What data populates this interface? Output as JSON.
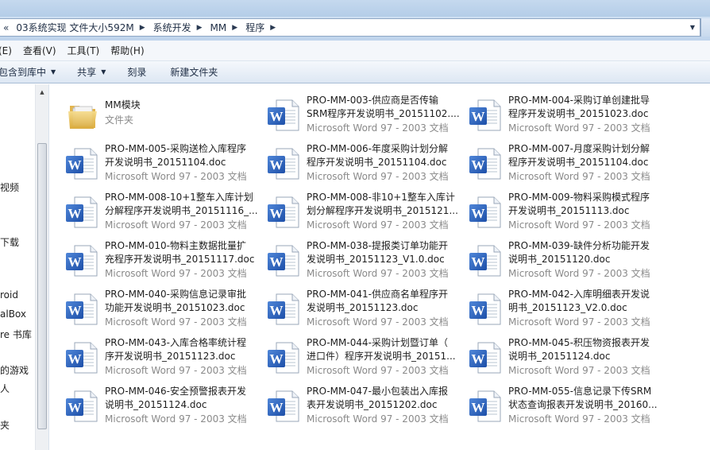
{
  "address": {
    "lead": "«",
    "crumbs": [
      "03系统实现 文件大小592M",
      "系统开发",
      "MM",
      "程序"
    ]
  },
  "menu": [
    "(E)",
    "查看(V)",
    "工具(T)",
    "帮助(H)"
  ],
  "commands": {
    "include_library": "包含到库中",
    "share": "共享",
    "burn": "刻录",
    "new_folder": "新建文件夹"
  },
  "nav": [
    "视频",
    "下载",
    "roid",
    "alBox",
    "re 书库",
    "的游戏",
    "人",
    "夹"
  ],
  "files": [
    {
      "line1": "MM模块",
      "line2": "",
      "line3": "文件夹",
      "icon": "folder-icon"
    },
    {
      "line1": "PRO-MM-003-供应商是否传输",
      "line2": "SRM程序开发说明书_20151102....",
      "line3": "Microsoft Word 97 - 2003 文档",
      "icon": "word-doc-icon"
    },
    {
      "line1": "PRO-MM-004-采购订单创建批导",
      "line2": "程序开发说明书_20151023.doc",
      "line3": "Microsoft Word 97 - 2003 文档",
      "icon": "word-doc-icon"
    },
    {
      "line1": "PRO-MM-005-采购送检入库程序",
      "line2": "开发说明书_20151104.doc",
      "line3": "Microsoft Word 97 - 2003 文档",
      "icon": "word-doc-icon"
    },
    {
      "line1": "PRO-MM-006-年度采购计划分解",
      "line2": "程序开发说明书_20151104.doc",
      "line3": "Microsoft Word 97 - 2003 文档",
      "icon": "word-doc-icon"
    },
    {
      "line1": "PRO-MM-007-月度采购计划分解",
      "line2": "程序开发说明书_20151104.doc",
      "line3": "Microsoft Word 97 - 2003 文档",
      "icon": "word-doc-icon"
    },
    {
      "line1": "PRO-MM-008-10+1整车入库计划",
      "line2": "分解程序开发说明书_20151116_...",
      "line3": "Microsoft Word 97 - 2003 文档",
      "icon": "word-doc-icon"
    },
    {
      "line1": "PRO-MM-008-非10+1整车入库计",
      "line2": "划分解程序开发说明书_2015121...",
      "line3": "Microsoft Word 97 - 2003 文档",
      "icon": "word-doc-icon"
    },
    {
      "line1": "PRO-MM-009-物料采购模式程序",
      "line2": "开发说明书_20151113.doc",
      "line3": "Microsoft Word 97 - 2003 文档",
      "icon": "word-doc-icon"
    },
    {
      "line1": "PRO-MM-010-物料主数据批量扩",
      "line2": "充程序开发说明书_20151117.doc",
      "line3": "Microsoft Word 97 - 2003 文档",
      "icon": "word-doc-icon"
    },
    {
      "line1": "PRO-MM-038-提报类订单功能开",
      "line2": "发说明书_20151123_V1.0.doc",
      "line3": "Microsoft Word 97 - 2003 文档",
      "icon": "word-doc-icon"
    },
    {
      "line1": "PRO-MM-039-缺件分析功能开发",
      "line2": "说明书_20151120.doc",
      "line3": "Microsoft Word 97 - 2003 文档",
      "icon": "word-doc-icon"
    },
    {
      "line1": "PRO-MM-040-采购信息记录审批",
      "line2": "功能开发说明书_20151023.doc",
      "line3": "Microsoft Word 97 - 2003 文档",
      "icon": "word-doc-icon"
    },
    {
      "line1": "PRO-MM-041-供应商名单程序开",
      "line2": "发说明书_20151123.doc",
      "line3": "Microsoft Word 97 - 2003 文档",
      "icon": "word-doc-icon"
    },
    {
      "line1": "PRO-MM-042-入库明细表开发说",
      "line2": "明书_20151123_V2.0.doc",
      "line3": "Microsoft Word 97 - 2003 文档",
      "icon": "word-doc-icon"
    },
    {
      "line1": "PRO-MM-043-入库合格率统计程",
      "line2": "序开发说明书_20151123.doc",
      "line3": "Microsoft Word 97 - 2003 文档",
      "icon": "word-doc-icon"
    },
    {
      "line1": "PRO-MM-044-采购计划暨订单（",
      "line2": "进口件）程序开发说明书_20151...",
      "line3": "Microsoft Word 97 - 2003 文档",
      "icon": "word-doc-icon"
    },
    {
      "line1": "PRO-MM-045-积压物资报表开发",
      "line2": "说明书_20151124.doc",
      "line3": "Microsoft Word 97 - 2003 文档",
      "icon": "word-doc-icon"
    },
    {
      "line1": "PRO-MM-046-安全预警报表开发",
      "line2": "说明书_20151124.doc",
      "line3": "Microsoft Word 97 - 2003 文档",
      "icon": "word-doc-icon"
    },
    {
      "line1": "PRO-MM-047-最小包装出入库报",
      "line2": "表开发说明书_20151202.doc",
      "line3": "Microsoft Word 97 - 2003 文档",
      "icon": "word-doc-icon"
    },
    {
      "line1": "PRO-MM-055-信息记录下传SRM",
      "line2": "状态查询报表开发说明书_20160...",
      "line3": "Microsoft Word 97 - 2003 文档",
      "icon": "word-doc-icon"
    }
  ]
}
